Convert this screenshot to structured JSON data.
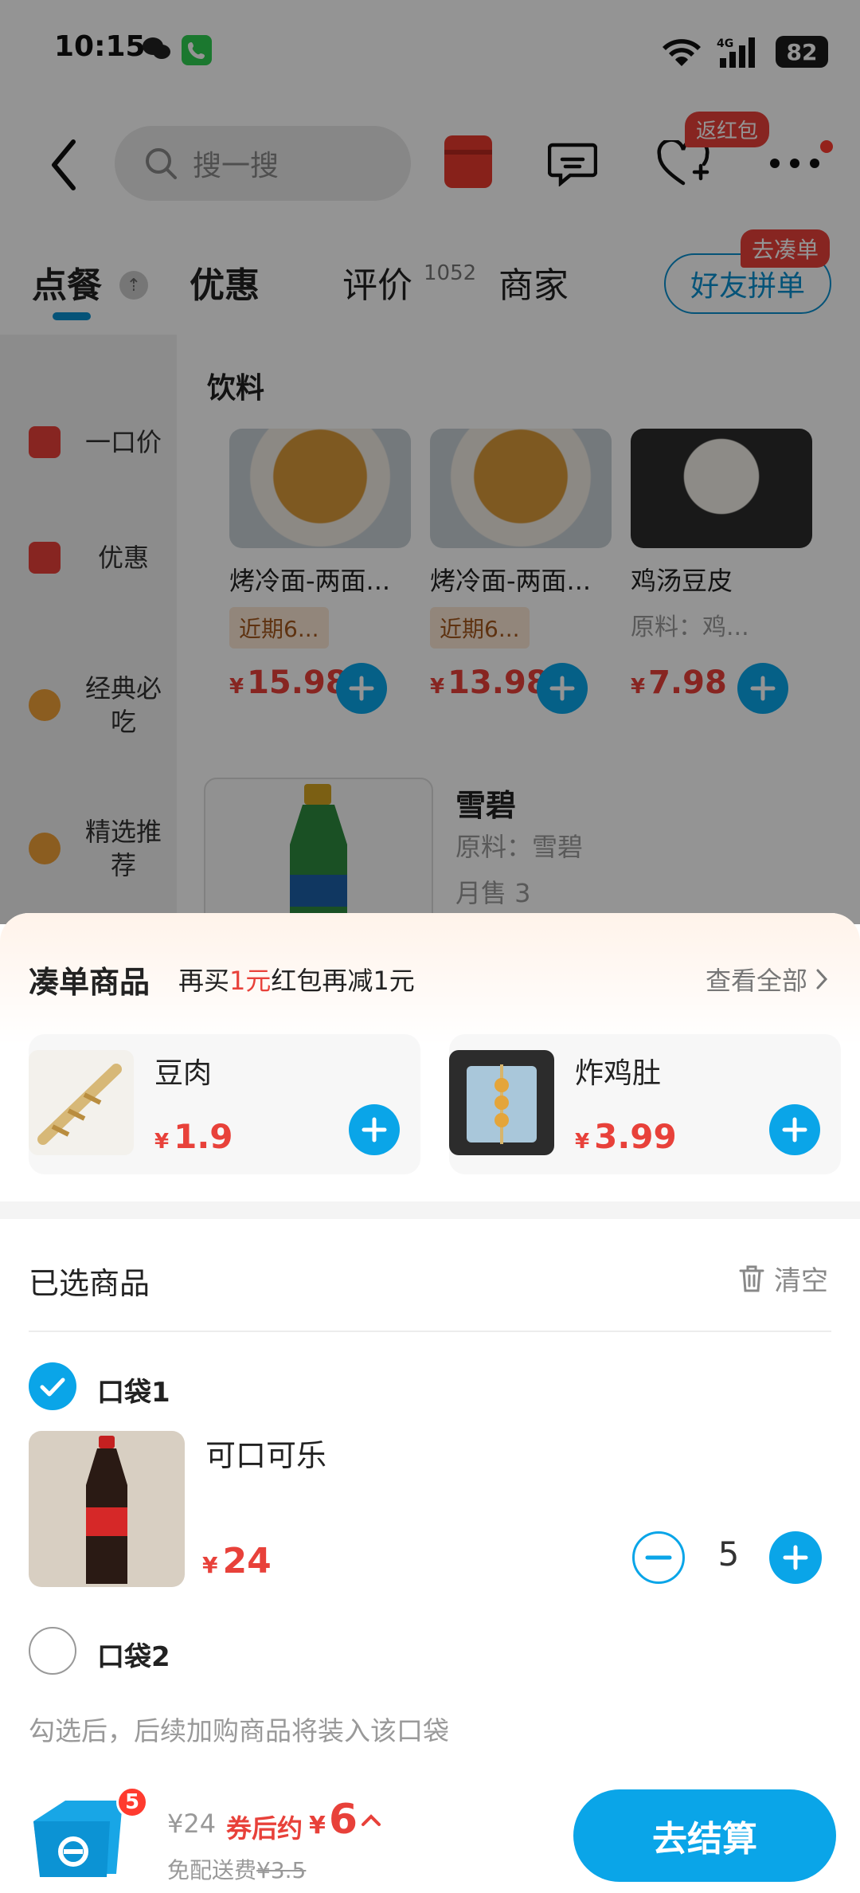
{
  "status_bar": {
    "time": "10:15",
    "battery": "82",
    "network": "4G"
  },
  "search": {
    "placeholder": "搜一搜"
  },
  "header": {
    "fanhongbao_badge": "返红包"
  },
  "tabs": {
    "items": [
      {
        "label": "点餐",
        "active": true
      },
      {
        "label": "优惠"
      },
      {
        "label": "评价"
      },
      {
        "label": "商家"
      }
    ],
    "review_count": "1052",
    "pin_badge": "⇡",
    "friend_button": "好友拼单",
    "coudan_badge": "去凑单"
  },
  "sidebar": {
    "items": [
      {
        "label": "一口价"
      },
      {
        "label": "优惠"
      },
      {
        "label": "经典必吃"
      },
      {
        "label": "精选推荐"
      }
    ]
  },
  "menu": {
    "section_title": "饮料",
    "cards": [
      {
        "name": "烤冷面-两面...",
        "tag": "近期6...",
        "price": "15.98"
      },
      {
        "name": "烤冷面-两面...",
        "tag": "近期6...",
        "price": "13.98"
      },
      {
        "name": "鸡汤豆皮",
        "sub": "原料：鸡...",
        "price": "7.98"
      }
    ],
    "featured": {
      "name": "雪碧",
      "ingredients": "原料：雪碧",
      "sold": "月售 3"
    }
  },
  "sheet": {
    "coudan_title": "凑单商品",
    "coudan_sub_pre": "再买",
    "coudan_sub_amount": "1元",
    "coudan_sub_post": "红包再减1元",
    "view_all": "查看全部",
    "recommendations": [
      {
        "name": "豆肉",
        "price": "1.9"
      },
      {
        "name": "炸鸡肚",
        "price": "3.99"
      }
    ],
    "selected_title": "已选商品",
    "clear": "清空",
    "bags": [
      {
        "label": "口袋1",
        "checked": true
      },
      {
        "label": "口袋2",
        "checked": false
      }
    ],
    "item": {
      "name": "可口可乐",
      "price": "24",
      "quantity": "5"
    },
    "hint": "勾选后，后续加购商品将装入该口袋"
  },
  "footer": {
    "cart_count": "5",
    "original_price": "¥24",
    "after_coupon_label": "券后约",
    "final_price": "6",
    "delivery_label": "免配送费",
    "delivery_orig": "¥3.5",
    "checkout": "去结算"
  },
  "colors": {
    "accent": "#0aa5e8",
    "price": "#e8413a",
    "badge": "#e8413a"
  },
  "currency": "¥"
}
